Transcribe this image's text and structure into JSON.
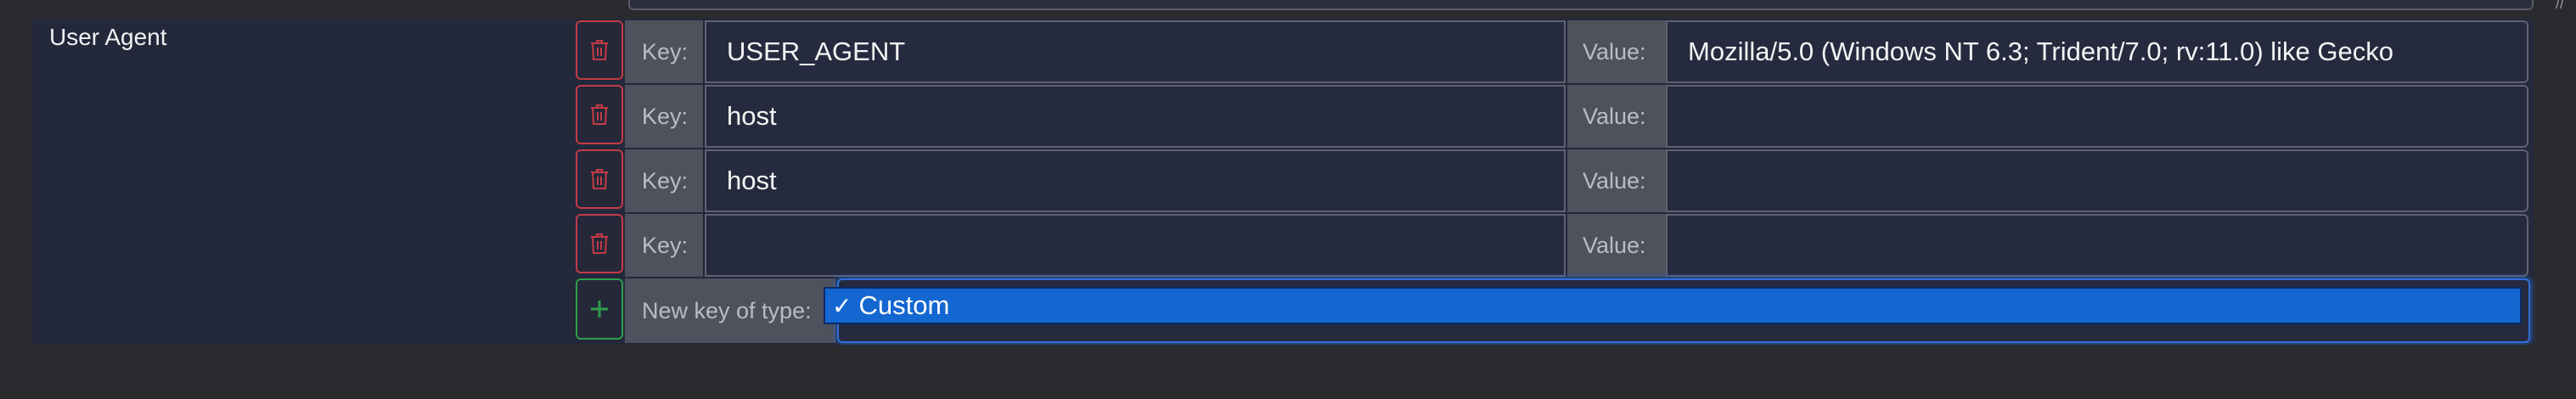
{
  "section": {
    "label": "User Agent"
  },
  "rows": [
    {
      "key_label": "Key:",
      "key": "USER_AGENT",
      "value_label": "Value:",
      "value": "Mozilla/5.0 (Windows NT 6.3; Trident/7.0; rv:11.0) like Gecko"
    },
    {
      "key_label": "Key:",
      "key": "host",
      "value_label": "Value:",
      "value": ""
    },
    {
      "key_label": "Key:",
      "key": "host",
      "value_label": "Value:",
      "value": ""
    },
    {
      "key_label": "Key:",
      "key": "",
      "value_label": "Value:",
      "value": ""
    }
  ],
  "new_key": {
    "label": "New key of type:",
    "selected": "Custom",
    "add_symbol": "+"
  },
  "colors": {
    "delete": "#c33b45",
    "add": "#2f9e4b",
    "selection": "#1467d1"
  },
  "icons": {
    "delete": "trash-icon",
    "add": "plus-icon",
    "check": "checkmark-icon"
  }
}
